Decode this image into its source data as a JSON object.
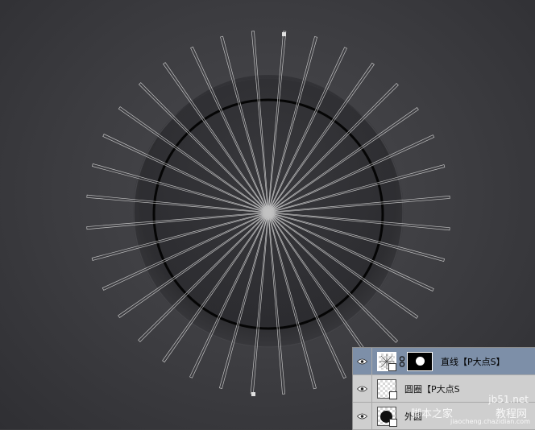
{
  "canvas": {
    "background": "#3c3c40",
    "ray_count": 36
  },
  "layers": [
    {
      "name": "直线【P大点S】",
      "selected": true,
      "has_mask": true
    },
    {
      "name": "圆圈【P大点S",
      "selected": false,
      "has_mask": false
    },
    {
      "name": "外圆",
      "selected": false,
      "has_mask": false
    }
  ],
  "watermark": {
    "site": "jb51.net",
    "label": "脚本之家",
    "label2": "教程网",
    "url": "jiaocheng.chazidian.com"
  },
  "colors": {
    "selected_row": "#7d8fa8",
    "panel_bg": "#cfcfcf"
  }
}
